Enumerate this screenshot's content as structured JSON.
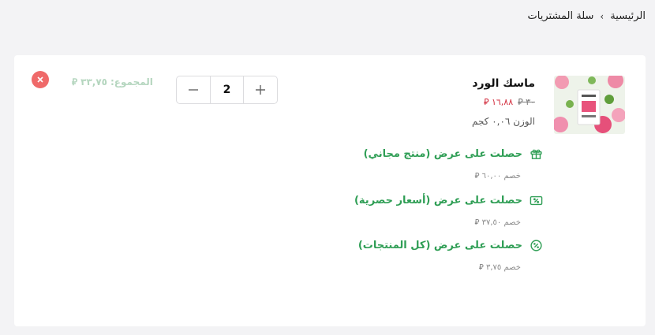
{
  "breadcrumb": {
    "home": "الرئيسية",
    "separator": "›",
    "current": "سلة المشتريات"
  },
  "item": {
    "name": "ماسك الورد",
    "image_icon": "rose-mask-product-image",
    "price_old": "٣٠",
    "price_new": "١٦,٨٨",
    "weight": "الوزن ٠,٠٦ كجم",
    "quantity": "2",
    "total_label": "المجموع:",
    "total_value": "٣٣,٧٥",
    "currency_symbol": "⃁"
  },
  "offers": [
    {
      "title": "حصلت على عرض (منتج مجاني)",
      "discount_label": "خصم",
      "discount_value": "٦٠,٠٠",
      "icon": "gift-icon"
    },
    {
      "title": "حصلت على عرض (أسعار حصرية)",
      "discount_label": "خصم",
      "discount_value": "٣٧,٥٠",
      "icon": "percent-tag-icon"
    },
    {
      "title": "حصلت على عرض (كل المنتجات)",
      "discount_label": "خصم",
      "discount_value": "٣,٧٥",
      "icon": "discount-badge-icon"
    }
  ],
  "colors": {
    "accent_green": "#2f9e55",
    "sale_red": "#d32f3f",
    "remove_red": "#ef6a6a"
  }
}
